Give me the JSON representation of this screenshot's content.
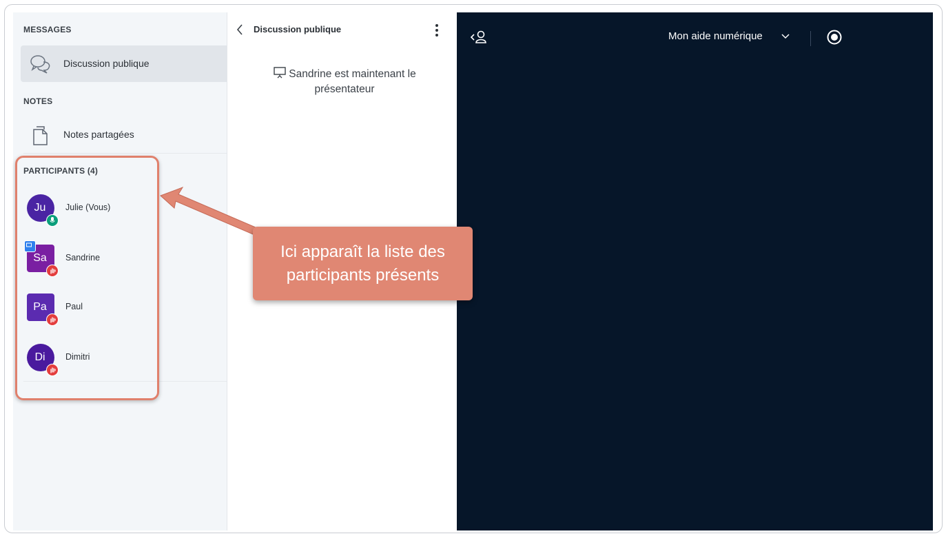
{
  "sidebar": {
    "messages_heading": "MESSAGES",
    "messages_item": "Discussion publique",
    "notes_heading": "NOTES",
    "notes_item": "Notes partagées",
    "participants_heading": "PARTICIPANTS (4)",
    "participants": [
      {
        "initials": "Ju",
        "name": "Julie (Vous)",
        "color": "#4a24a3",
        "shape": "round",
        "status": "microphone",
        "status_color": "#0a9e7b",
        "presenter": false
      },
      {
        "initials": "Sa",
        "name": "Sandrine",
        "color": "#7a1fa2",
        "shape": "square",
        "status": "raised-hand",
        "status_color": "#e33d3d",
        "presenter": true
      },
      {
        "initials": "Pa",
        "name": "Paul",
        "color": "#5b2bb0",
        "shape": "square",
        "status": "raised-hand",
        "status_color": "#e33d3d",
        "presenter": false
      },
      {
        "initials": "Di",
        "name": "Dimitri",
        "color": "#4a1a9e",
        "shape": "round",
        "status": "raised-hand",
        "status_color": "#e33d3d",
        "presenter": false
      }
    ]
  },
  "chat": {
    "title": "Discussion publique",
    "presenter_message": "Sandrine est maintenant le présentateur"
  },
  "main": {
    "title": "Mon aide numérique"
  },
  "annotation": {
    "callout_text": "Ici apparaît la liste des participants présents",
    "color": "#e08773"
  },
  "colors": {
    "main_bg": "#061629",
    "sidebar_bg": "#f3f6f9",
    "selected_item": "#e1e5ea"
  }
}
